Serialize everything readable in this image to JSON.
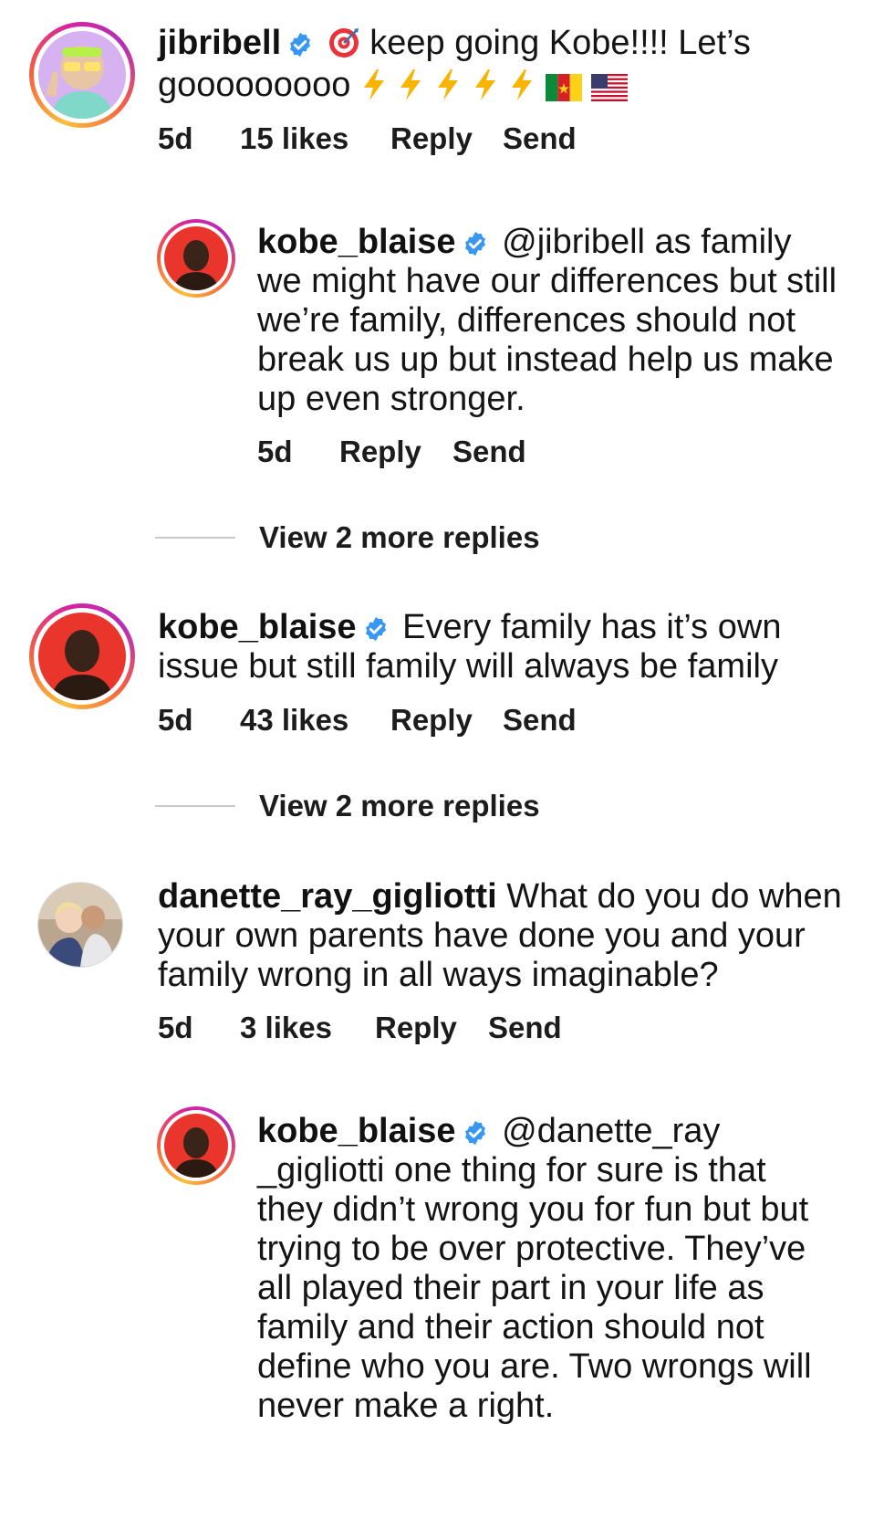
{
  "comments": [
    {
      "username": "jibribell",
      "verified": true,
      "text": "keep going Kobe!!!! Let’s gooooooooo",
      "emoji": [
        "target-emoji",
        "lightning-emoji",
        "lightning-emoji",
        "lightning-emoji",
        "lightning-emoji",
        "lightning-emoji",
        "cameroon-flag",
        "us-flag"
      ],
      "time": "5d",
      "likes": "15 likes",
      "reply_label": "Reply",
      "send_label": "Send"
    },
    {
      "username": "kobe_blaise",
      "verified": true,
      "text": "@jibribell as family we might have our differences but still we’re family, differences should not break us up but instead help us make up even stronger.",
      "time": "5d",
      "reply_label": "Reply",
      "send_label": "Send"
    },
    {
      "username": "kobe_blaise",
      "verified": true,
      "text": "Every family has it’s own issue but still family will always be family",
      "time": "5d",
      "likes": "43 likes",
      "reply_label": "Reply",
      "send_label": "Send"
    },
    {
      "username": "danette_ray_gigliotti",
      "verified": false,
      "text": "What do you do when your own parents have done you and your family wrong in all ways imaginable?",
      "time": "5d",
      "likes": "3 likes",
      "reply_label": "Reply",
      "send_label": "Send"
    },
    {
      "username": "kobe_blaise",
      "verified": true,
      "text": "@danette_ray _gigliotti one thing for sure is that they didn’t wrong you for fun but but trying to be over protective.  They’ve all played their part in your life as family  and their action should not define who you are. Two wrongs will never make a right."
    }
  ],
  "view_replies": [
    {
      "label": "View 2 more replies"
    },
    {
      "label": "View 2 more replies"
    }
  ],
  "colors": {
    "verified": "#3897f0",
    "text": "#141414",
    "divider": "#c9c9c9"
  }
}
